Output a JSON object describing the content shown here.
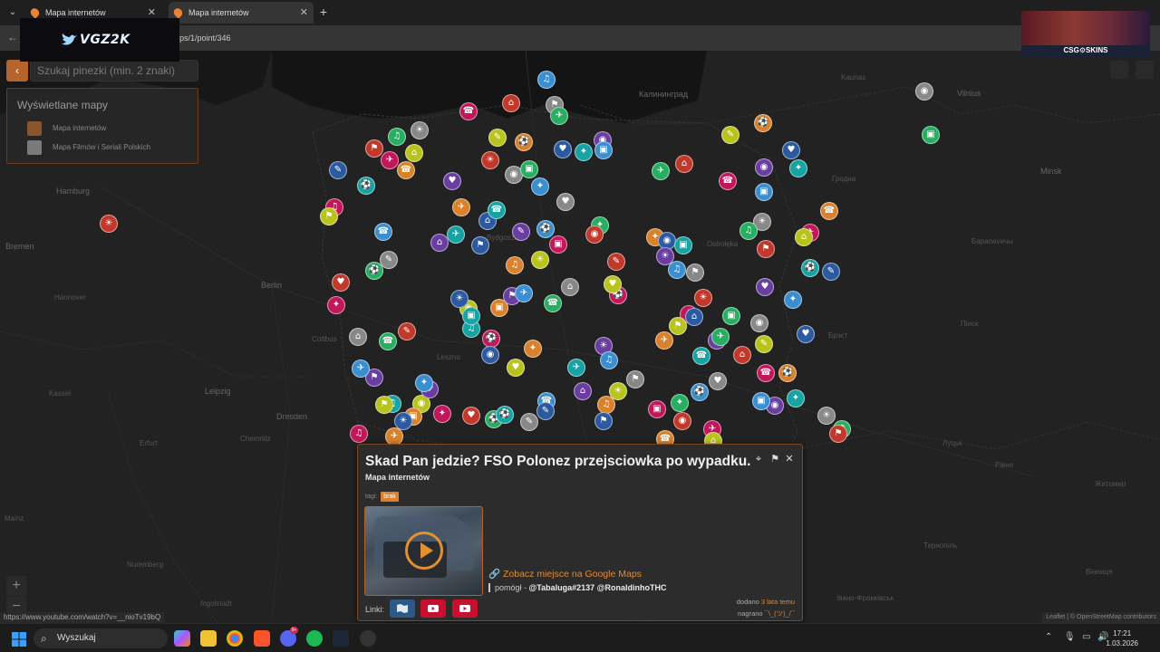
{
  "browser": {
    "tabs": [
      {
        "title": "Mapa internetów",
        "active": false
      },
      {
        "title": "Mapa internetów",
        "active": true
      }
    ],
    "url_fragment": "ps/1/point/346",
    "status_url": "https://www.youtube.com/watch?v=__nioTv19bQ"
  },
  "overlays": {
    "logo_text": "VGZ2K",
    "stream_brand": "CSG⚙SKINS"
  },
  "search": {
    "placeholder": "Szukaj pinezki (min. 2 znaki)",
    "back_icon": "‹"
  },
  "layers": {
    "title": "Wyświetlane mapy",
    "items": [
      {
        "label": "Mapa internetów",
        "color": "#8a5528"
      },
      {
        "label": "Mapa Filmów i Seriali Polskich",
        "color": "#7a7a7a"
      }
    ]
  },
  "map": {
    "places": [
      {
        "name": "Hamburg",
        "big": true
      },
      {
        "name": "Bremen",
        "big": true
      },
      {
        "name": "Hannover",
        "big": false
      },
      {
        "name": "Berlin",
        "big": true
      },
      {
        "name": "Leipzig",
        "big": true
      },
      {
        "name": "Dresden",
        "big": true
      },
      {
        "name": "Kassel",
        "big": false
      },
      {
        "name": "Nuremberg",
        "big": false
      },
      {
        "name": "Калининград",
        "big": true
      },
      {
        "name": "Kaunas",
        "big": false
      },
      {
        "name": "Vilnius",
        "big": true
      },
      {
        "name": "Minsk",
        "big": true
      },
      {
        "name": "Гродна",
        "big": false
      },
      {
        "name": "Брэст",
        "big": false
      },
      {
        "name": "Луцьк",
        "big": false
      },
      {
        "name": "Рівне",
        "big": false
      },
      {
        "name": "Житомир",
        "big": false
      },
      {
        "name": "Тернопіль",
        "big": false
      },
      {
        "name": "Вінниця",
        "big": false
      },
      {
        "name": "Івано-Франківськ",
        "big": false
      },
      {
        "name": "Ostrołęka",
        "big": false
      },
      {
        "name": "Bydgoszcz",
        "big": false
      },
      {
        "name": "Leszno",
        "big": false
      },
      {
        "name": "Cottbus",
        "big": false
      },
      {
        "name": "Chemnitz",
        "big": false
      },
      {
        "name": "Erfurt",
        "big": false
      },
      {
        "name": "Mainz",
        "big": false
      },
      {
        "name": "Ingolstadt",
        "big": false
      },
      {
        "name": "Бараnavичы",
        "big": false
      },
      {
        "name": "Пінск",
        "big": false
      }
    ]
  },
  "popup": {
    "title": "Skad Pan jedzie? FSO Polonez przejsciowka po wypadku...",
    "subtitle": "Mapa internetów",
    "tags_label": "tagi:",
    "tag": "brak",
    "gmaps_link": "Zobacz miejsce na Google Maps",
    "helped_prefix": "pomógł -",
    "helped_users": "@Tabaluga#2137 @RonaldinhoTHC",
    "links_label": "Linki:",
    "added_prefix": "dodano",
    "added_value": "3 lata temu",
    "recorded_prefix": "nagrano",
    "recorded_value": "¯\\_(ツ)_/¯"
  },
  "attribution": "Leaflet | © OpenStreetMap contributors",
  "taskbar": {
    "search_label": "Wyszukaj",
    "time": "17:21",
    "date": "1.03.2026",
    "discord_badge": "9+"
  },
  "zoom": {
    "in": "+",
    "out": "−"
  },
  "colors": {
    "accent": "#d9822b",
    "map_bg": "#222222",
    "popup_border": "#7b4a22"
  }
}
